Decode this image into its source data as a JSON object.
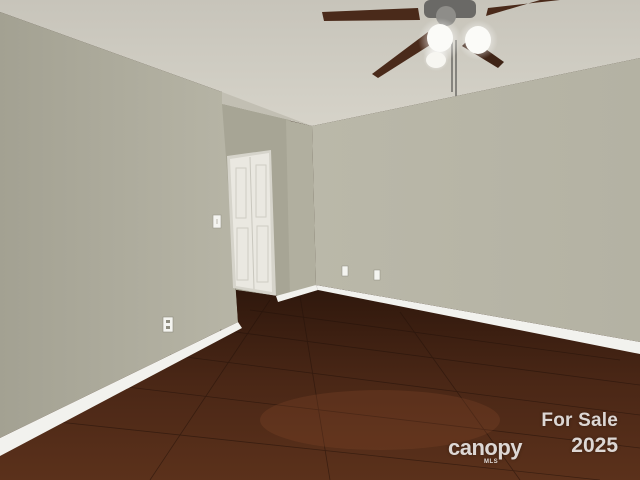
{
  "watermark": {
    "headline": "For Sale",
    "brand": "canopy",
    "brand_sub": "MLS",
    "year": "2025"
  },
  "colors": {
    "wall_light": "#bcbaab",
    "wall_shadow": "#9c9a8b",
    "ceiling": "#cfccc2",
    "floor": "#3a2013",
    "baseboard": "#f2f2ee",
    "door": "#eceae3"
  }
}
